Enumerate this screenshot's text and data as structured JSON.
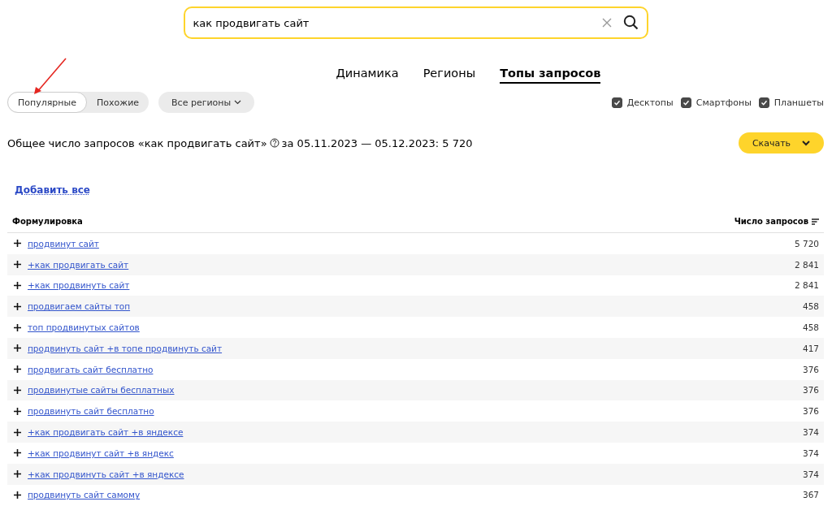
{
  "search": {
    "value": "как продвигать сайт"
  },
  "tabs": [
    {
      "label": "Динамика",
      "selected": false
    },
    {
      "label": "Регионы",
      "selected": false
    },
    {
      "label": "Топы запросов",
      "selected": true
    }
  ],
  "mode_switch": [
    {
      "label": "Популярные",
      "selected": true
    },
    {
      "label": "Похожие",
      "selected": false
    }
  ],
  "region_dropdown": "Все регионы",
  "devices": [
    {
      "label": "Десктопы",
      "checked": true
    },
    {
      "label": "Смартфоны",
      "checked": true
    },
    {
      "label": "Планшеты",
      "checked": true
    }
  ],
  "summary": {
    "before": "Общее число запросов «как продвигать сайт»",
    "after": "за 05.11.2023 — 05.12.2023: 5 720"
  },
  "download_button": "Скачать",
  "add_all_link": "Добавить все",
  "table": {
    "columns": [
      "Формулировка",
      "Число запросов"
    ],
    "rows": [
      {
        "phrase": "продвинут сайт",
        "count": "5 720"
      },
      {
        "phrase": "+как продвигать сайт",
        "count": "2 841"
      },
      {
        "phrase": "+как продвинуть сайт",
        "count": "2 841"
      },
      {
        "phrase": "продвигаем сайты топ",
        "count": "458"
      },
      {
        "phrase": "топ продвинутых сайтов",
        "count": "458"
      },
      {
        "phrase": "продвинуть сайт +в топе продвинуть сайт",
        "count": "417"
      },
      {
        "phrase": "продвигать сайт бесплатно",
        "count": "376"
      },
      {
        "phrase": "продвинутые сайты бесплатных",
        "count": "376"
      },
      {
        "phrase": "продвинуть сайт бесплатно",
        "count": "376"
      },
      {
        "phrase": "+как продвигать сайт +в яндексе",
        "count": "374"
      },
      {
        "phrase": "+как продвинут сайт +в яндекс",
        "count": "374"
      },
      {
        "phrase": "+как продвинуть сайт +в яндексе",
        "count": "374"
      },
      {
        "phrase": "продвинуть сайт самому",
        "count": "367"
      }
    ]
  }
}
